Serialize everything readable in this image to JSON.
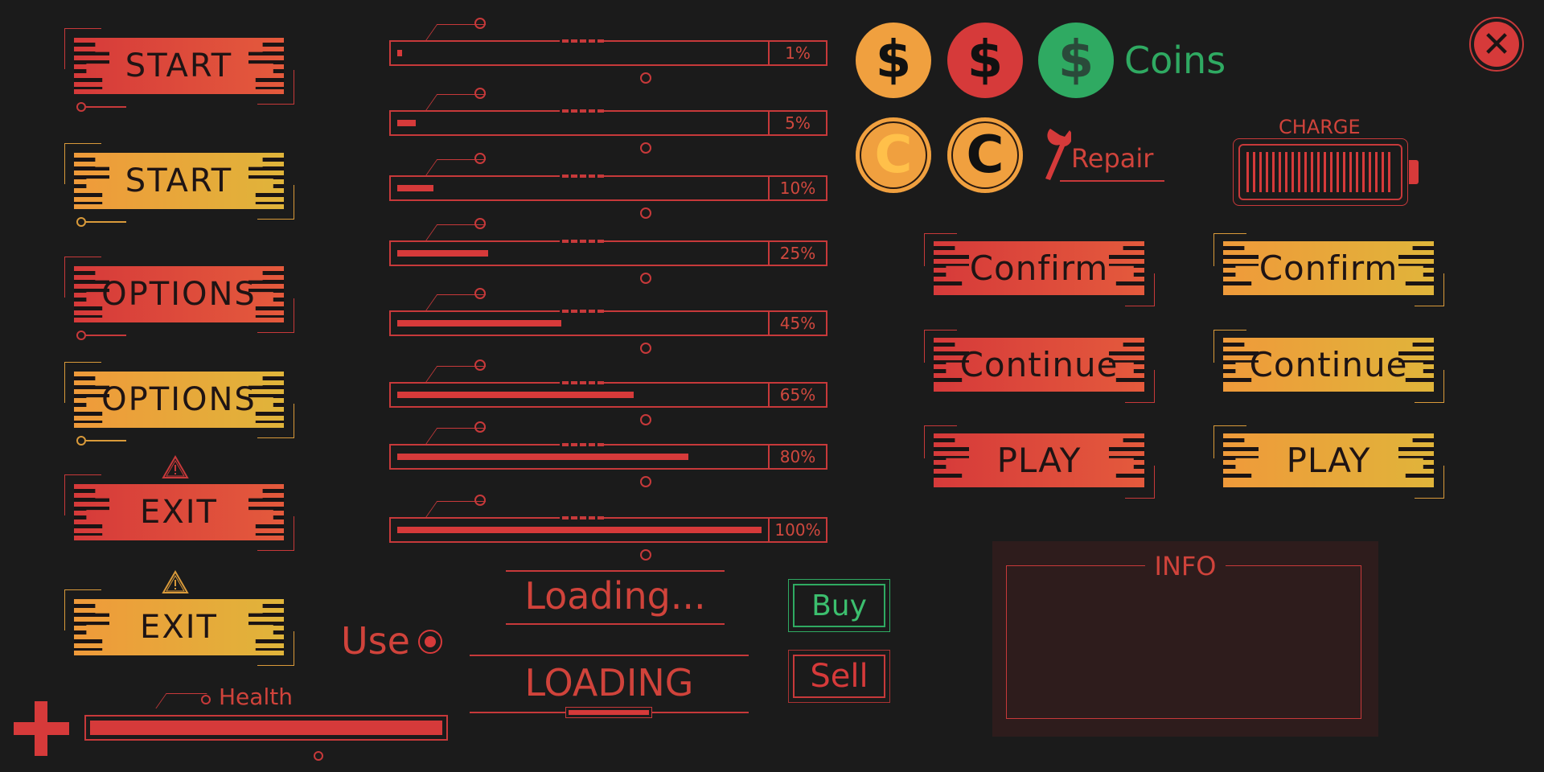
{
  "colors": {
    "red": "#d63a3a",
    "orange": "#ef9a3a",
    "yellow": "#e0b43a",
    "green": "#2faa62",
    "bg": "#1b1b1b"
  },
  "menu_buttons": [
    {
      "label": "START",
      "style": "red"
    },
    {
      "label": "START",
      "style": "yellow"
    },
    {
      "label": "OPTIONS",
      "style": "red"
    },
    {
      "label": "OPTIONS",
      "style": "yellow"
    },
    {
      "label": "EXIT",
      "style": "red",
      "icon": "warning-icon"
    },
    {
      "label": "EXIT",
      "style": "yellow",
      "icon": "warning-icon"
    }
  ],
  "progress_bars": [
    {
      "value": 1,
      "label": "1%"
    },
    {
      "value": 5,
      "label": "5%"
    },
    {
      "value": 10,
      "label": "10%"
    },
    {
      "value": 25,
      "label": "25%"
    },
    {
      "value": 45,
      "label": "45%"
    },
    {
      "value": 65,
      "label": "65%"
    },
    {
      "value": 80,
      "label": "80%"
    },
    {
      "value": 100,
      "label": "100%"
    }
  ],
  "coins": {
    "dollar_symbol": "$",
    "c_symbol": "C",
    "label": "Coins"
  },
  "repair": {
    "label": "Repair",
    "icon": "wrench-icon"
  },
  "charge": {
    "label": "CHARGE",
    "level_percent": 100
  },
  "close": {
    "icon": "close-icon"
  },
  "action_buttons": {
    "red": [
      "Confirm",
      "Continue",
      "PLAY"
    ],
    "yellow": [
      "Confirm",
      "Continue",
      "PLAY"
    ]
  },
  "loading": {
    "text1": "Loading...",
    "text2": "LOADING"
  },
  "use": {
    "label": "Use"
  },
  "shop": {
    "buy": "Buy",
    "sell": "Sell"
  },
  "health": {
    "label": "Health",
    "value_percent": 100
  },
  "info": {
    "title": "INFO"
  }
}
